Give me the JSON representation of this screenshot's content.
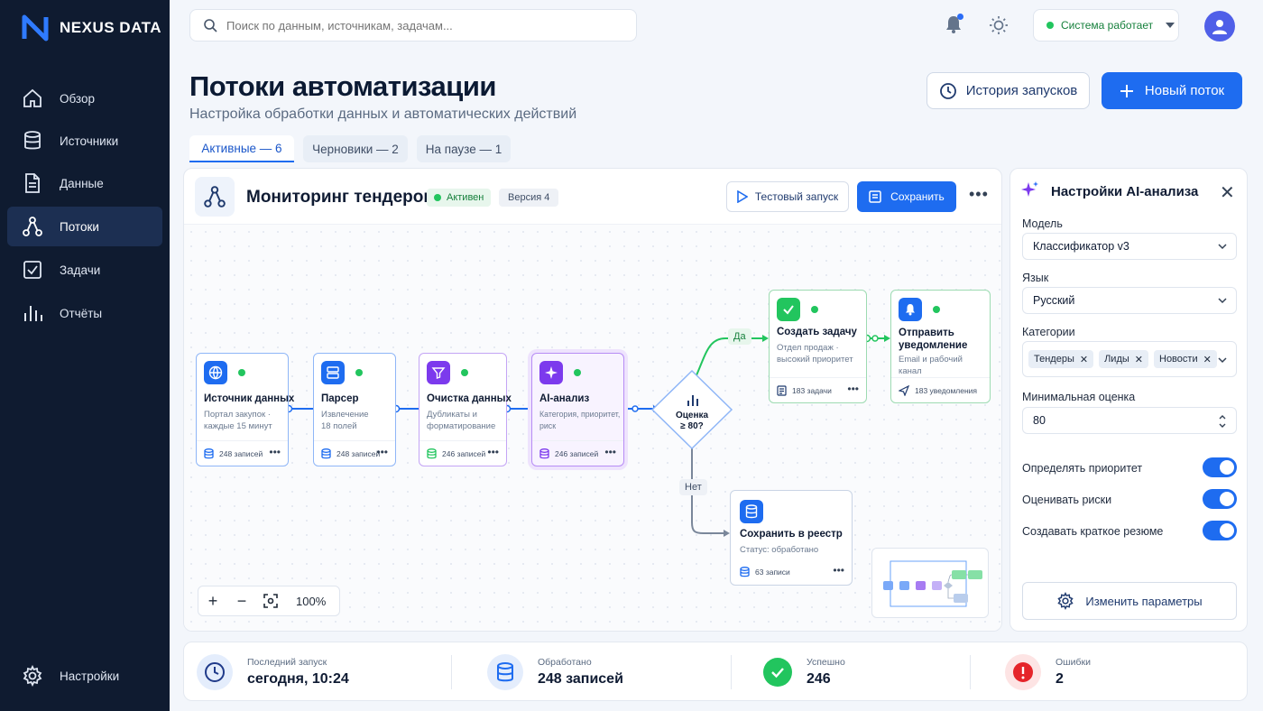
{
  "app": {
    "name": "NEXUS DATA"
  },
  "sidebar": {
    "items": [
      {
        "label": "Обзор",
        "icon": "home-icon"
      },
      {
        "label": "Источники",
        "icon": "database-icon"
      },
      {
        "label": "Данные",
        "icon": "file-icon"
      },
      {
        "label": "Потоки",
        "icon": "flow-icon",
        "active": true
      },
      {
        "label": "Задачи",
        "icon": "checkbox-icon"
      },
      {
        "label": "Отчёты",
        "icon": "bar-chart-icon"
      }
    ],
    "settings_label": "Настройки"
  },
  "topbar": {
    "search_placeholder": "Поиск по данным, источникам, задачам...",
    "status_label": "Система работает"
  },
  "header": {
    "title": "Потоки автоматизации",
    "subtitle": "Настройка обработки данных и автоматических действий",
    "history_button": "История запусков",
    "new_button": "Новый поток"
  },
  "tabs": [
    {
      "label": "Активные — 6",
      "active": true
    },
    {
      "label": "Черновики — 2"
    },
    {
      "label": "На паузе — 1"
    }
  ],
  "flow": {
    "title": "Мониторинг тендеров",
    "status_badge": "Активен",
    "version_badge": "Версия 4",
    "test_button": "Тестовый запуск",
    "save_button": "Сохранить",
    "zoom": "100%",
    "nodes": {
      "source": {
        "title": "Источник данных",
        "desc": "Портал закупок ·\nкаждые 15 минут",
        "count": "248 записей"
      },
      "parser": {
        "title": "Парсер",
        "desc": "Извлечение\n18 полей",
        "count": "248 записей"
      },
      "clean": {
        "title": "Очистка данных",
        "desc": "Дубликаты и\nформатирование",
        "count": "246 записей"
      },
      "ai": {
        "title": "AI-анализ",
        "desc": "Категория, приоритет,\nриск",
        "count": "246 записей"
      },
      "decision": {
        "label": "Оценка\n≥ 80?"
      },
      "task": {
        "title": "Создать задачу",
        "desc": "Отдел продаж ·\nвысокий приоритет",
        "count": "183 задачи"
      },
      "notify": {
        "title": "Отправить\nуведомление",
        "desc": "Email и рабочий\nканал",
        "count": "183 уведомления"
      },
      "registry": {
        "title": "Сохранить в реестр",
        "desc": "Статус: обработано",
        "count": "63 записи"
      }
    },
    "branch_yes": "Да",
    "branch_no": "Нет"
  },
  "panel": {
    "title": "Настройки AI-анализа",
    "model_label": "Модель",
    "model_value": "Классификатор v3",
    "language_label": "Язык",
    "language_value": "Русский",
    "categories_label": "Категории",
    "categories": [
      "Тендеры",
      "Лиды",
      "Новости"
    ],
    "min_score_label": "Минимальная оценка",
    "min_score_value": "80",
    "toggles": [
      {
        "label": "Определять приоритет",
        "on": true
      },
      {
        "label": "Оценивать риски",
        "on": true
      },
      {
        "label": "Создавать краткое резюме",
        "on": true
      }
    ],
    "params_button": "Изменить параметры"
  },
  "stats": [
    {
      "label": "Последний запуск",
      "value": "сегодня, 10:24",
      "icon": "clock-icon"
    },
    {
      "label": "Обработано",
      "value": "248 записей",
      "icon": "database-icon"
    },
    {
      "label": "Успешно",
      "value": "246",
      "icon": "check-circle-icon"
    },
    {
      "label": "Ошибки",
      "value": "2",
      "icon": "error-icon"
    }
  ],
  "colors": {
    "accent": "#1e6cf0",
    "sidebar": "#0f1b30",
    "success": "#22c55e",
    "purple": "#7c3aed",
    "error": "#e5252a"
  }
}
